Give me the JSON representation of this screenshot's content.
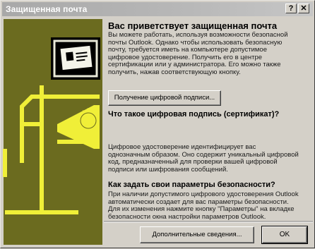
{
  "window": {
    "title": "Защищенная почта",
    "help_label": "?",
    "close_label": "✕"
  },
  "main": {
    "heading": "Вас приветствует защищенная почта",
    "intro": "Вы можете работать, используя возможности безопасной почты Outlook. Однако чтобы использовать безопасную почту, требуется иметь на компьютере допустимое цифровое удостоверение. Получить его в центре сертификации или у администратора. Его можно также получить, нажав соответствующую кнопку.",
    "get_id_label": "Получение цифровой подписи...",
    "section1_title": "Что такое цифровая подпись (сертификат)?",
    "section1_text": "Цифровое удостоверение идентифицирует вас однозначным образом. Оно содержит уникальный цифровой код, предназначенный для проверки вашей цифровой подписи или шифрования сообщений.",
    "section2_title": "Как задать свои параметры безопасности?",
    "section2_text": "При наличии допустимого цифрового удостоверения Outlook автоматически создает для вас параметры безопасности. Для их изменения нажмите кнопку \"Параметры\" на вкладке безопасности окна настройки параметров Outlook."
  },
  "footer": {
    "more_info_label": "Дополнительные сведения...",
    "ok_label": "OK"
  },
  "colors": {
    "art_green": "#6b6b1f",
    "art_yellow": "#f0ef38",
    "panel_gray": "#d4d0c8"
  },
  "icons": [
    "help-icon",
    "close-icon",
    "certificate-icon",
    "seal-icon"
  ]
}
